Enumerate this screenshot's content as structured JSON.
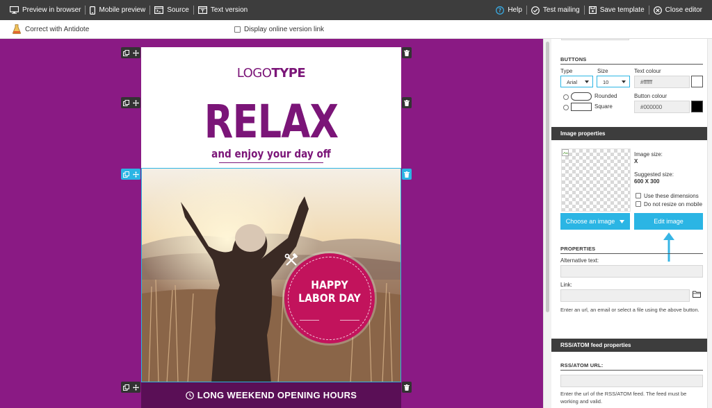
{
  "toolbar": {
    "left": [
      {
        "label": "Preview in browser",
        "icon": "monitor-icon"
      },
      {
        "label": "Mobile preview",
        "icon": "mobile-icon"
      },
      {
        "label": "Source",
        "icon": "source-code-icon"
      },
      {
        "label": "Text version",
        "icon": "text-version-icon"
      }
    ],
    "right": [
      {
        "label": "Help",
        "icon": "help-icon"
      },
      {
        "label": "Test mailing",
        "icon": "check-circle-icon"
      },
      {
        "label": "Save template",
        "icon": "save-icon"
      },
      {
        "label": "Close editor",
        "icon": "close-circle-icon"
      }
    ]
  },
  "subbar": {
    "antidote": "Correct with Antidote",
    "online_link": "Display online version link"
  },
  "email": {
    "logo_light": "LOGO",
    "logo_bold": "TYPE",
    "headline": "RELAX",
    "subheadline": "and enjoy your day off",
    "badge_line1": "HAPPY",
    "badge_line2": "LABOR DAY",
    "footer_banner": "LONG WEEKEND OPENING HOURS"
  },
  "panel": {
    "buttons_section": {
      "title": "BUTTONS",
      "type_label": "Type",
      "type_value": "Arial",
      "size_label": "Size",
      "size_value": "10",
      "text_colour_label": "Text colour",
      "text_colour_value": "#ffffff",
      "shape_rounded": "Rounded",
      "shape_square": "Square",
      "button_colour_label": "Button colour",
      "button_colour_value": "#000000"
    },
    "image_properties": {
      "title": "Image properties",
      "image_size_label": "Image size:",
      "image_size_value": "X",
      "suggested_size_label": "Suggested size:",
      "suggested_size_value": "600 X 300",
      "use_dimensions": "Use these dimensions",
      "no_resize": "Do not resize on mobile",
      "choose_image": "Choose an image",
      "edit_image": "Edit image"
    },
    "properties": {
      "title": "PROPERTIES",
      "alt_label": "Alternative text:",
      "link_label": "Link:",
      "link_note": "Enter an url, an email or select a file using the above button."
    },
    "rss": {
      "title": "RSS/ATOM feed properties",
      "url_label": "RSS/ATOM URL:",
      "note": "Enter the url of the RSS/ATOM feed. The feed must be working and valid."
    }
  },
  "colors": {
    "canvas": "#8a1a84",
    "brand_purple": "#7b1578",
    "badge": "#c2135c",
    "accent_blue": "#2bb5e4",
    "toolbar": "#3d3d3d"
  }
}
